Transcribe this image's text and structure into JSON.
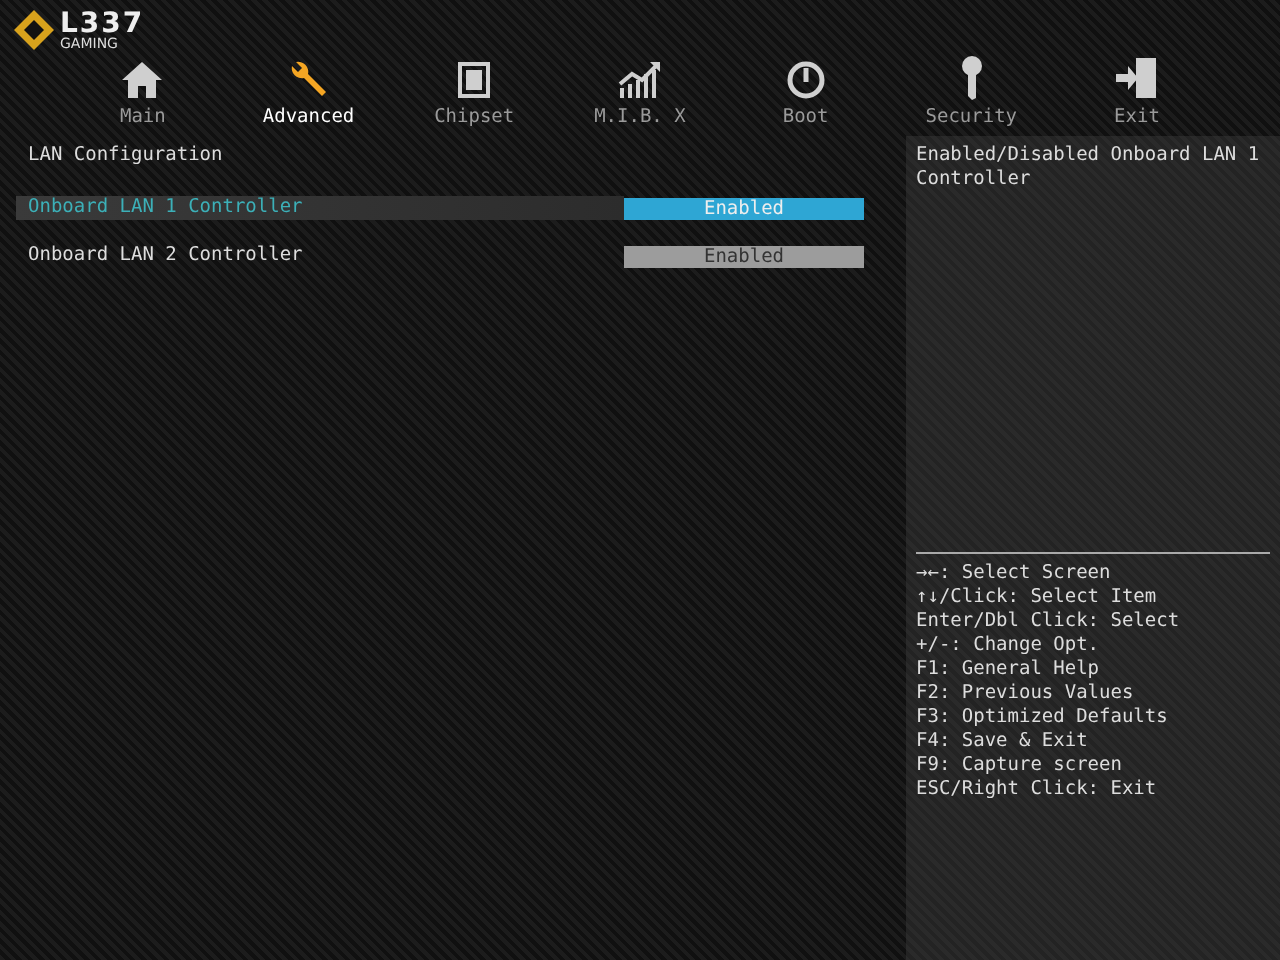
{
  "logo": {
    "brand": "L337",
    "subtitle": "GAMING"
  },
  "tabs": [
    {
      "label": "Main",
      "kind": "home",
      "selected": false
    },
    {
      "label": "Advanced",
      "kind": "wrench",
      "selected": true
    },
    {
      "label": "Chipset",
      "kind": "chip",
      "selected": false
    },
    {
      "label": "M.I.B. X",
      "kind": "chart",
      "selected": false
    },
    {
      "label": "Boot",
      "kind": "power",
      "selected": false
    },
    {
      "label": "Security",
      "kind": "key",
      "selected": false
    },
    {
      "label": "Exit",
      "kind": "exit",
      "selected": false
    }
  ],
  "section_title": "LAN Configuration",
  "settings": [
    {
      "label": "Onboard LAN 1 Controller",
      "value": "Enabled",
      "selected": true
    },
    {
      "label": "Onboard LAN 2 Controller",
      "value": "Enabled",
      "selected": false
    }
  ],
  "help": {
    "description": "Enabled/Disabled Onboard LAN 1 Controller",
    "keys": [
      "→←: Select Screen",
      "↑↓/Click: Select Item",
      "Enter/Dbl Click: Select",
      "+/-: Change Opt.",
      "F1: General Help",
      "F2: Previous Values",
      "F3: Optimized Defaults",
      "F4: Save & Exit",
      "F9: Capture screen",
      "ESC/Right Click: Exit"
    ]
  }
}
